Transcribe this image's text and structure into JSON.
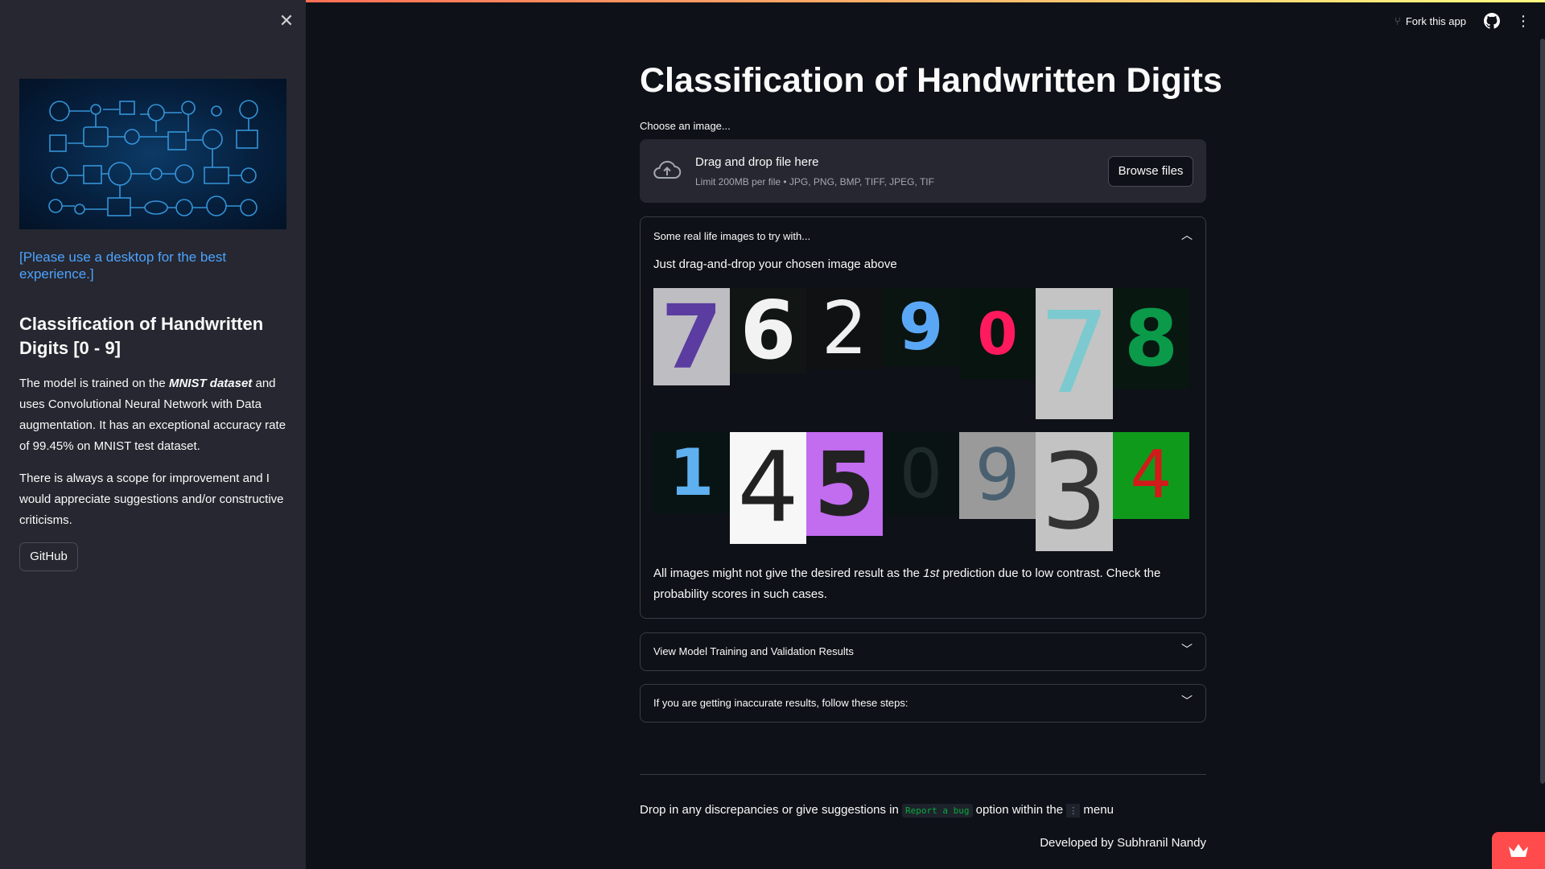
{
  "header": {
    "fork_label": "Fork this app",
    "github_icon": "github-icon",
    "menu_icon": "kebab-menu-icon"
  },
  "sidebar": {
    "close_icon": "close-icon",
    "desktop_note": "[Please use a desktop for the best experience.]",
    "title": "Classification of Handwritten Digits [0 - 9]",
    "para1_pre": "The model is trained on the ",
    "para1_em": "MNIST dataset",
    "para1_post": " and uses Convolutional Neural Network with Data augmentation. It has an exceptional accuracy rate of 99.45% on MNIST test dataset.",
    "para2": "There is always a scope for improvement and I would appreciate suggestions and/or constructive criticisms.",
    "github_button": "GitHub"
  },
  "main": {
    "title": "Classification of Handwritten Digits",
    "uploader": {
      "label": "Choose an image...",
      "drop_title": "Drag and drop file here",
      "drop_sub": "Limit 200MB per file • JPG, PNG, BMP, TIFF, JPEG, TIF",
      "browse": "Browse files"
    },
    "expander1": {
      "header": "Some real life images to try with...",
      "intro": "Just drag-and-drop your chosen image above",
      "note_pre": "All images might not give the desired result as the ",
      "note_em": "1st",
      "note_post": " prediction due to low contrast. Check the probability scores in such cases.",
      "images_row1": [
        "7",
        "6",
        "2",
        "9",
        "0",
        "7",
        "8"
      ],
      "images_row2": [
        "1",
        "4",
        "5",
        "0",
        "9",
        "3",
        "4"
      ]
    },
    "expander2": {
      "header": "View Model Training and Validation Results"
    },
    "expander3": {
      "header": "If you are getting inaccurate results, follow these steps:"
    },
    "footer": {
      "text_pre": "Drop in any discrepancies or give suggestions in ",
      "code": "Report a bug",
      "text_mid": " option within the ",
      "dots": "⋮",
      "text_post": " menu",
      "developer": "Developed by Subhranil Nandy"
    }
  }
}
